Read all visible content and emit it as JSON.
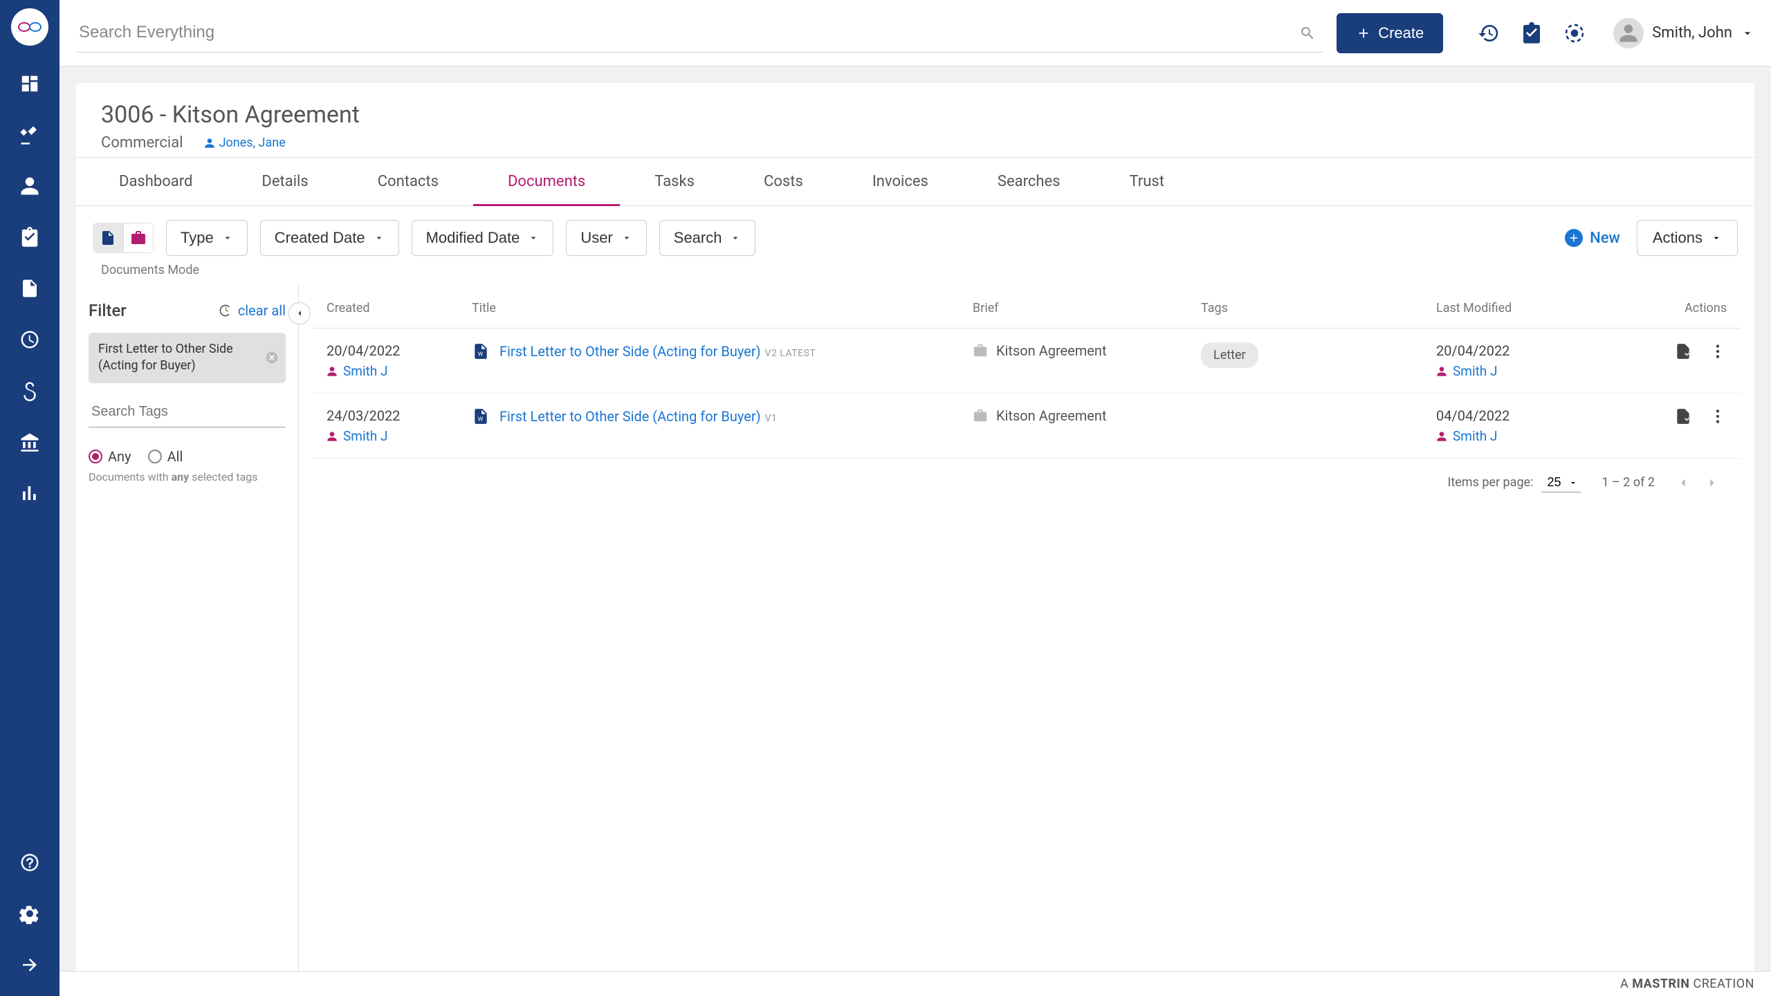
{
  "topbar": {
    "search_placeholder": "Search Everything",
    "create_label": "Create",
    "user_name": "Smith, John"
  },
  "matter": {
    "title": "3006 - Kitson Agreement",
    "category": "Commercial",
    "assigned": "Jones, Jane"
  },
  "tabs": [
    "Dashboard",
    "Details",
    "Contacts",
    "Documents",
    "Tasks",
    "Costs",
    "Invoices",
    "Searches",
    "Trust"
  ],
  "active_tab": "Documents",
  "toolbar": {
    "filters": [
      "Type",
      "Created Date",
      "Modified Date",
      "User",
      "Search"
    ],
    "new_label": "New",
    "actions_label": "Actions",
    "mode_label": "Documents Mode"
  },
  "filter_panel": {
    "title": "Filter",
    "clear_label": "clear all",
    "chip": "First Letter to Other Side (Acting for Buyer)",
    "tag_search_placeholder": "Search Tags",
    "radio_any": "Any",
    "radio_all": "All",
    "hint_prefix": "Documents with ",
    "hint_bold": "any",
    "hint_suffix": " selected tags"
  },
  "table": {
    "headers": {
      "created": "Created",
      "title": "Title",
      "brief": "Brief",
      "tags": "Tags",
      "modified": "Last Modified",
      "actions": "Actions"
    },
    "rows": [
      {
        "created_date": "20/04/2022",
        "created_user": "Smith J",
        "title": "First Letter to Other Side (Acting for Buyer)",
        "version": "V2 LATEST",
        "brief": "Kitson Agreement",
        "tags": [
          "Letter"
        ],
        "modified_date": "20/04/2022",
        "modified_user": "Smith J"
      },
      {
        "created_date": "24/03/2022",
        "created_user": "Smith J",
        "title": "First Letter to Other Side (Acting for Buyer)",
        "version": "V1",
        "brief": "Kitson Agreement",
        "tags": [],
        "modified_date": "04/04/2022",
        "modified_user": "Smith J"
      }
    ]
  },
  "paginator": {
    "items_per_page_label": "Items per page:",
    "page_size": "25",
    "range": "1 – 2 of 2"
  },
  "footer": {
    "prefix": "A ",
    "brand": "MASTRIN",
    "suffix": " CREATION"
  }
}
